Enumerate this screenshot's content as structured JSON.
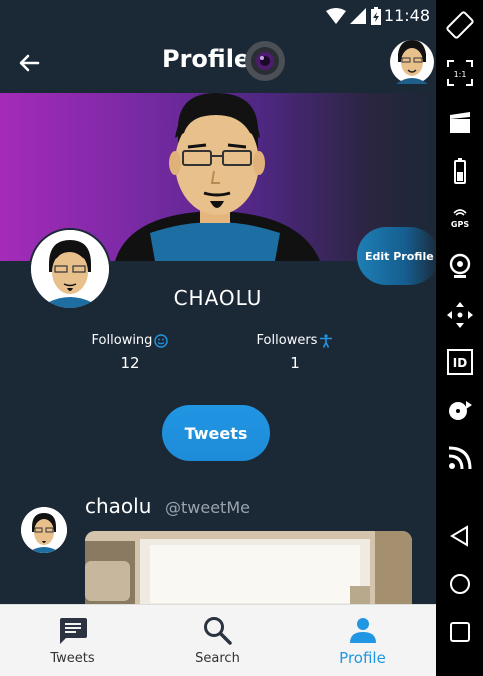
{
  "status_bar": {
    "time": "11:48"
  },
  "app_bar": {
    "title": "Profile"
  },
  "profile": {
    "edit_label": "Edit Profile",
    "username": "CHAOLU",
    "following_label": "Following",
    "following_count": "12",
    "followers_label": "Followers",
    "followers_count": "1",
    "tweets_button": "Tweets"
  },
  "tweet": {
    "name": "chaolu",
    "handle": "@tweetMe"
  },
  "bottom_nav": {
    "items": [
      {
        "label": "Tweets",
        "icon": "chat-bubble-icon"
      },
      {
        "label": "Search",
        "icon": "search-icon"
      },
      {
        "label": "Profile",
        "icon": "person-icon"
      }
    ],
    "active_color": "#2196e3"
  },
  "side_toolbar": {
    "items": [
      "rotate-icon",
      "resize-icon",
      "clapperboard-icon",
      "battery-icon",
      "gps-icon",
      "camera-icon",
      "move-icon",
      "id-icon",
      "media-icon",
      "rss-icon",
      "back-icon",
      "home-icon",
      "recents-icon"
    ],
    "resize_text": "1:1",
    "gps_text": "GPS",
    "id_text": "ID"
  },
  "colors": {
    "background": "#1b2836",
    "accent": "#2196e3",
    "banner_start": "#a52bb8"
  }
}
